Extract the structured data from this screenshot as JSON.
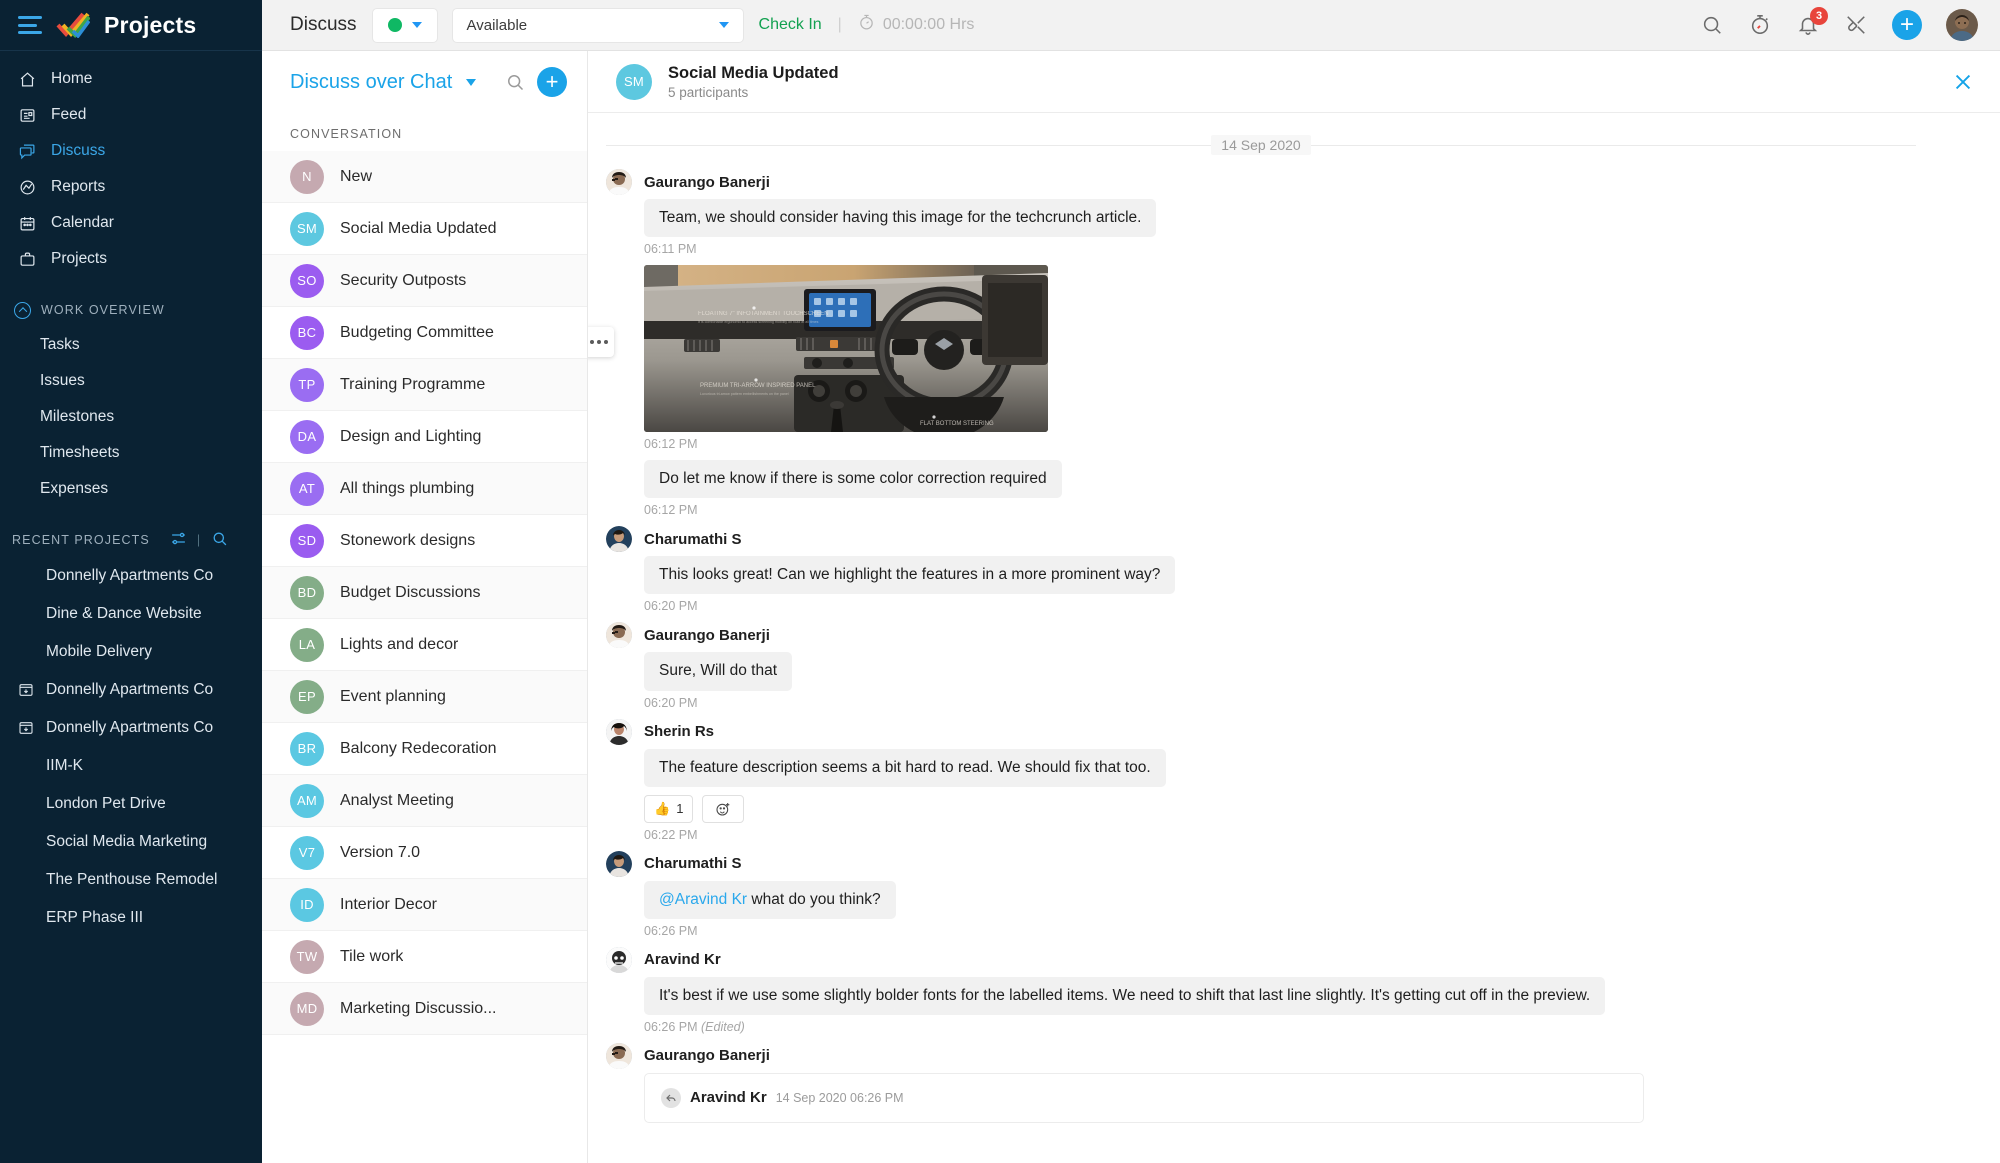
{
  "brand": {
    "title": "Projects",
    "logo_icon": "double-check-logo"
  },
  "sidebar": {
    "nav": [
      {
        "label": "Home",
        "icon": "home-icon",
        "active": false
      },
      {
        "label": "Feed",
        "icon": "feed-icon",
        "active": false
      },
      {
        "label": "Discuss",
        "icon": "discuss-icon",
        "active": true
      },
      {
        "label": "Reports",
        "icon": "reports-icon",
        "active": false
      },
      {
        "label": "Calendar",
        "icon": "calendar-icon",
        "active": false
      },
      {
        "label": "Projects",
        "icon": "projects-icon",
        "active": false
      }
    ],
    "work_overview": {
      "label": "WORK OVERVIEW",
      "items": [
        {
          "label": "Tasks"
        },
        {
          "label": "Issues"
        },
        {
          "label": "Milestones"
        },
        {
          "label": "Timesheets"
        },
        {
          "label": "Expenses"
        }
      ]
    },
    "recent_projects": {
      "label": "RECENT PROJECTS",
      "filter_icon": "sliders-icon",
      "search_icon": "search-icon",
      "divider": "|",
      "items": [
        {
          "label": "Donnelly Apartments Co",
          "icon": false
        },
        {
          "label": "Dine & Dance Website",
          "icon": false
        },
        {
          "label": "Mobile Delivery",
          "icon": false
        },
        {
          "label": "Donnelly Apartments Co",
          "icon": true
        },
        {
          "label": "Donnelly Apartments Co",
          "icon": true
        },
        {
          "label": "IIM-K",
          "icon": false
        },
        {
          "label": "London Pet Drive",
          "icon": false
        },
        {
          "label": "Social Media Marketing",
          "icon": false
        },
        {
          "label": "The Penthouse Remodel",
          "icon": false
        },
        {
          "label": "ERP Phase III",
          "icon": false
        }
      ]
    }
  },
  "topbar": {
    "page_title": "Discuss",
    "status_dot_color": "#0fb864",
    "status_value": "Available",
    "check_in_label": "Check In",
    "separator": "|",
    "timer_text": "00:00:00 Hrs",
    "timer_icon": "stopwatch-icon",
    "icons": {
      "search": "search-icon",
      "timer": "timer-icon",
      "notifications": "bell-icon",
      "notifications_badge": "3",
      "tools": "tools-icon",
      "add": "plus-icon",
      "avatar": "user-avatar"
    }
  },
  "conversations": {
    "header_title": "Discuss over Chat",
    "header_caret": "chevron-down-icon",
    "search_icon": "search-icon",
    "add_icon": "plus-icon",
    "section_label": "CONVERSATION",
    "items": [
      {
        "initials": "N",
        "name": "New",
        "color": "#c5a9b0"
      },
      {
        "initials": "SM",
        "name": "Social Media Updated",
        "color": "#5dc8e0",
        "selected": true
      },
      {
        "initials": "SO",
        "name": "Security Outposts",
        "color": "#9b5cf0"
      },
      {
        "initials": "BC",
        "name": "Budgeting Committee",
        "color": "#9b5cf0"
      },
      {
        "initials": "TP",
        "name": "Training Programme",
        "color": "#9a6df2"
      },
      {
        "initials": "DA",
        "name": "Design and Lighting",
        "color": "#9a6df2"
      },
      {
        "initials": "AT",
        "name": "All things plumbing",
        "color": "#9a6df2"
      },
      {
        "initials": "SD",
        "name": "Stonework designs",
        "color": "#9a5cf0"
      },
      {
        "initials": "BD",
        "name": "Budget Discussions",
        "color": "#84ad88"
      },
      {
        "initials": "LA",
        "name": "Lights and decor",
        "color": "#84ad88"
      },
      {
        "initials": "EP",
        "name": "Event planning",
        "color": "#84ad88"
      },
      {
        "initials": "BR",
        "name": "Balcony Redecoration",
        "color": "#5bc8e2"
      },
      {
        "initials": "AM",
        "name": "Analyst Meeting",
        "color": "#5bc8e2"
      },
      {
        "initials": "V7",
        "name": "Version 7.0",
        "color": "#5bc8e2"
      },
      {
        "initials": "ID",
        "name": "Interior Decor",
        "color": "#5bc8e2"
      },
      {
        "initials": "TW",
        "name": "Tile work",
        "color": "#c5a9b0"
      },
      {
        "initials": "MD",
        "name": "Marketing Discussio...",
        "color": "#c5a9b0"
      }
    ]
  },
  "chat": {
    "header": {
      "initials": "SM",
      "avatar_color": "#5dc8e0",
      "title": "Social Media Updated",
      "participants": "5 participants",
      "close_icon": "close-icon"
    },
    "date_separator": "14 Sep 2020",
    "messages": [
      {
        "author": "Gaurango Banerji",
        "type": "text",
        "text": "Team, we should consider having this image for the techcrunch article.",
        "time": "06:11 PM"
      },
      {
        "author": "",
        "type": "image",
        "image_alt": "car-dashboard-interior-photo",
        "image_labels": [
          "FLOATING 7\" INFOTAINMENT TOUCHSCREEN",
          "PREMIUM TRI-ARROW INSPIRED PANEL",
          "FLAT BOTTOM STEERING"
        ],
        "more_icon": "more-options-icon",
        "time": "06:12 PM"
      },
      {
        "author": "",
        "type": "text",
        "text": "Do let me know if there is some color correction required",
        "time": "06:12 PM"
      },
      {
        "author": "Charumathi S",
        "type": "text",
        "text": "This looks great! Can we highlight the features in a more prominent way?",
        "time": "06:20 PM"
      },
      {
        "author": "Gaurango Banerji",
        "type": "text",
        "text": "Sure, Will do that",
        "time": "06:20 PM"
      },
      {
        "author": "Sherin Rs",
        "type": "text",
        "text": "The feature description seems a bit hard to read. We should fix that too.",
        "time": "06:22 PM",
        "reactions": [
          {
            "emoji": "👍",
            "count": "1",
            "name": "thumbs-up-reaction"
          },
          {
            "emoji": "",
            "count": "",
            "name": "add-reaction-icon"
          }
        ]
      },
      {
        "author": "Charumathi S",
        "type": "mention",
        "mention": "@Aravind Kr",
        "text": " what do you think?",
        "time": "06:26 PM"
      },
      {
        "author": "Aravind Kr",
        "type": "text",
        "text": "It's best if we use some slightly bolder fonts for the labelled items. We need to shift that last line slightly. It's getting cut off in the preview.",
        "time": "06:26 PM",
        "edited": "(Edited)"
      },
      {
        "author": "Gaurango Banerji",
        "type": "quote",
        "quote_author": "Aravind Kr",
        "quote_time": "14 Sep 2020 06:26 PM",
        "quote_icon": "reply-icon"
      }
    ]
  }
}
